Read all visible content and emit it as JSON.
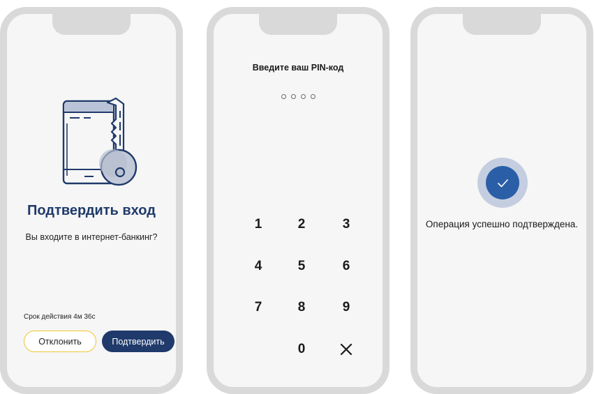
{
  "confirm_screen": {
    "title": "Подтвердить вход",
    "subtitle": "Вы входите в интернет-банкинг?",
    "validity": "Срок действия 4м 36с",
    "decline_label": "Отклонить",
    "confirm_label": "Подтвердить",
    "icon": "phone-key-icon"
  },
  "pin_screen": {
    "title": "Введите ваш PIN-код",
    "dots_count": 4,
    "keys": [
      "1",
      "2",
      "3",
      "4",
      "5",
      "6",
      "7",
      "8",
      "9",
      "0"
    ],
    "delete_icon": "close-icon"
  },
  "success_screen": {
    "message": "Операция успешно подтверждена.",
    "icon": "checkmark-icon"
  },
  "colors": {
    "primary": "#1f3a6b",
    "accent_yellow": "#f0c52f",
    "check_blue": "#2a5fa8",
    "check_ring": "#c5cee0",
    "bezel": "#d9d9d9",
    "screen_bg": "#f6f6f6"
  }
}
